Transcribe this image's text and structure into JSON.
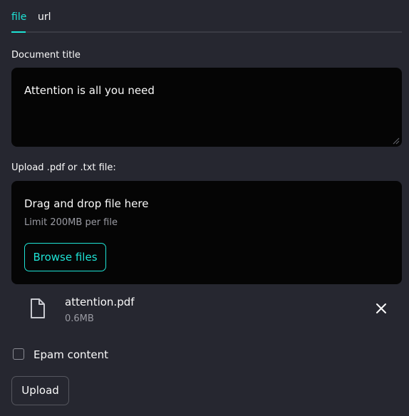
{
  "tabs": [
    {
      "label": "file",
      "active": true
    },
    {
      "label": "url",
      "active": false
    }
  ],
  "document": {
    "label": "Document title",
    "value": "Attention is all you need"
  },
  "upload": {
    "label": "Upload .pdf or .txt file:",
    "drop_title": "Drag and drop file here",
    "drop_limit": "Limit 200MB per file",
    "browse_label": "Browse files"
  },
  "file": {
    "name": "attention.pdf",
    "size": "0.6MB",
    "icon": "file-icon"
  },
  "checkbox": {
    "label": "Epam content",
    "checked": false
  },
  "submit": {
    "label": "Upload"
  },
  "colors": {
    "background": "#262730",
    "accent": "#1ee3d5",
    "field": "#050505",
    "muted_text": "#9a9ba3"
  }
}
